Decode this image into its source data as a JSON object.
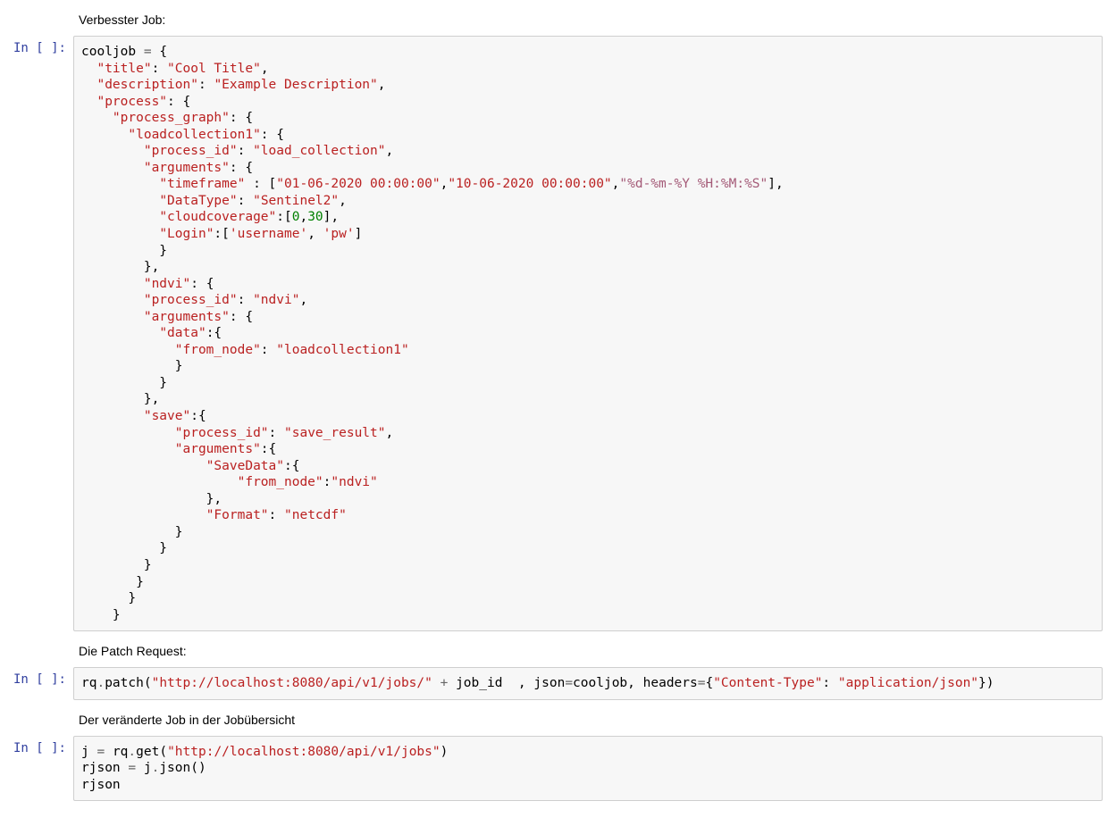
{
  "prompts": {
    "in_empty": "In [ ]:"
  },
  "markdown": {
    "md1": "Verbesster Job:",
    "md2": "Die Patch Request:",
    "md3": "Der veränderte Job in der Jobübersicht"
  },
  "code1": {
    "l01_var": "cooljob",
    "l01_op": " = ",
    "l01_brace": "{",
    "l02_key": "\"title\"",
    "l02_val": "\"Cool Title\"",
    "l03_key": "\"description\"",
    "l03_val": "\"Example Description\"",
    "l04_key": "\"process\"",
    "l05_key": "\"process_graph\"",
    "l06_key": "\"loadcollection1\"",
    "l07_key": "\"process_id\"",
    "l07_val": "\"load_collection\"",
    "l08_key": "\"arguments\"",
    "l09_key": "\"timeframe\"",
    "l09_v1": "\"01-06-2020 00:00:00\"",
    "l09_v2": "\"10-06-2020 00:00:00\"",
    "l09_fmt": "\"%d-%m-%Y %H:%M:%S\"",
    "l10_key": "\"DataType\"",
    "l10_val": "\"Sentinel2\"",
    "l11_key": "\"cloudcoverage\"",
    "l11_n1": "0",
    "l11_n2": "30",
    "l12_key": "\"Login\"",
    "l12_v1": "'username'",
    "l12_v2": "'pw'",
    "l15_key": "\"ndvi\"",
    "l16_key": "\"process_id\"",
    "l16_val": "\"ndvi\"",
    "l17_key": "\"arguments\"",
    "l18_key": "\"data\"",
    "l19_key": "\"from_node\"",
    "l19_val": "\"loadcollection1\"",
    "l23_key": "\"save\"",
    "l24_key": "\"process_id\"",
    "l24_val": "\"save_result\"",
    "l25_key": "\"arguments\"",
    "l26_key": "\"SaveData\"",
    "l27_key": "\"from_node\"",
    "l27_val": "\"ndvi\"",
    "l29_key": "\"Format\"",
    "l29_val": "\"netcdf\""
  },
  "code2": {
    "rq": "rq",
    "dot1": ".",
    "patch": "patch",
    "op1": "(",
    "url": "\"http://localhost:8080/api/v1/jobs/\"",
    "plus": " + ",
    "jobid": "job_id  ",
    "comma1": ", ",
    "json_kw": "json",
    "eq1": "=",
    "cooljob": "cooljob",
    "comma2": ", ",
    "headers": "headers",
    "eq2": "=",
    "brace_o": "{",
    "hkey": "\"Content-Type\"",
    "colon": ": ",
    "hval": "\"application/json\"",
    "brace_c": "}",
    "close": ")"
  },
  "code3": {
    "l1_j": "j",
    "l1_eq": " = ",
    "l1_rq": "rq",
    "l1_dot": ".",
    "l1_get": "get",
    "l1_op": "(",
    "l1_url": "\"http://localhost:8080/api/v1/jobs\"",
    "l1_cl": ")",
    "l2_rjson": "rjson",
    "l2_eq": " = ",
    "l2_j": "j",
    "l2_dot": ".",
    "l2_json": "json",
    "l2_par": "()",
    "l3": "rjson"
  }
}
